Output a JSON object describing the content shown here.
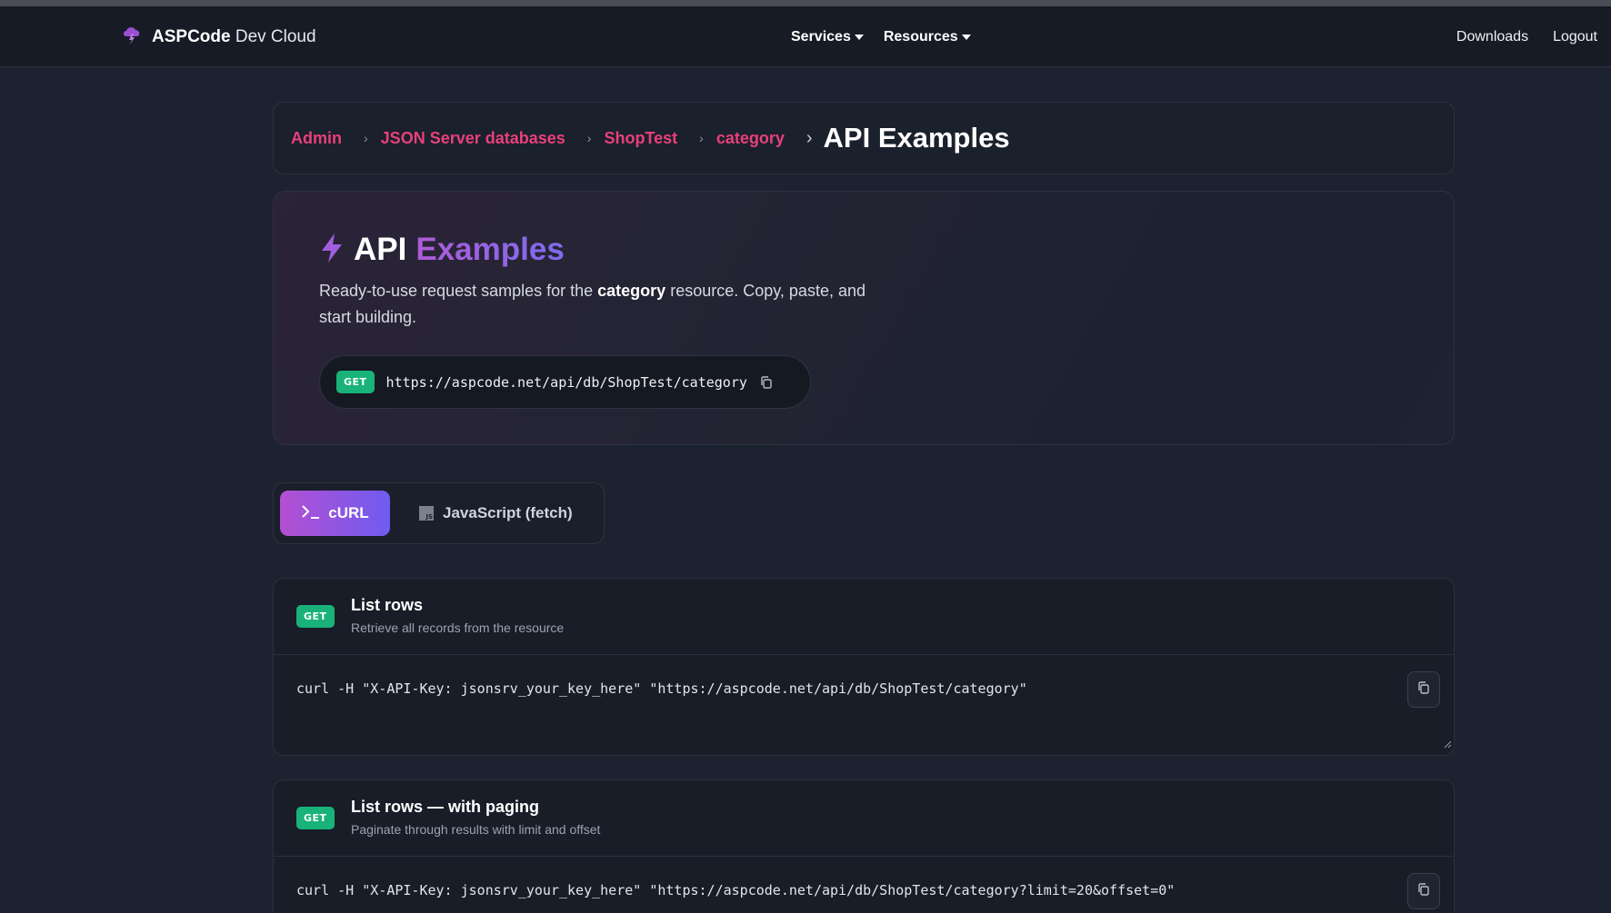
{
  "navbar": {
    "brand_bold": "ASPCode",
    "brand_rest": " Dev Cloud",
    "menu": [
      {
        "label": "Services"
      },
      {
        "label": "Resources"
      }
    ],
    "downloads": "Downloads",
    "logout": "Logout"
  },
  "breadcrumb": {
    "items": [
      "Admin",
      "JSON Server databases",
      "ShopTest",
      "category"
    ],
    "current": "API Examples"
  },
  "hero": {
    "title_plain": "API",
    "title_gradient": "Examples",
    "desc_before": "Ready-to-use request samples for the ",
    "desc_bold": "category",
    "desc_after": " resource. Copy, paste, and start building.",
    "method": "GET",
    "url": "https://aspcode.net/api/db/ShopTest/category"
  },
  "tabs": {
    "curl": "cURL",
    "js": "JavaScript (fetch)",
    "js_badge": "JS",
    "active": "cURL"
  },
  "examples": [
    {
      "method": "GET",
      "title": "List rows",
      "subtitle": "Retrieve all records from the resource",
      "code": "curl -H \"X-API-Key: jsonsrv_your_key_here\" \"https://aspcode.net/api/db/ShopTest/category\""
    },
    {
      "method": "GET",
      "title": "List rows — with paging",
      "subtitle": "Paginate through results with limit and offset",
      "code": "curl -H \"X-API-Key: jsonsrv_your_key_here\" \"https://aspcode.net/api/db/ShopTest/category?limit=20&offset=0\""
    }
  ],
  "colors": {
    "accent_pink": "#e8407a",
    "get_badge": "#19b27a",
    "gradient_start": "#b44fd2",
    "gradient_end": "#6f5cf0"
  },
  "icons": {
    "brand": "cloud-bolt-icon",
    "hero": "lightning-icon",
    "copy": "copy-icon",
    "terminal": "terminal-icon",
    "js": "javascript-icon"
  }
}
